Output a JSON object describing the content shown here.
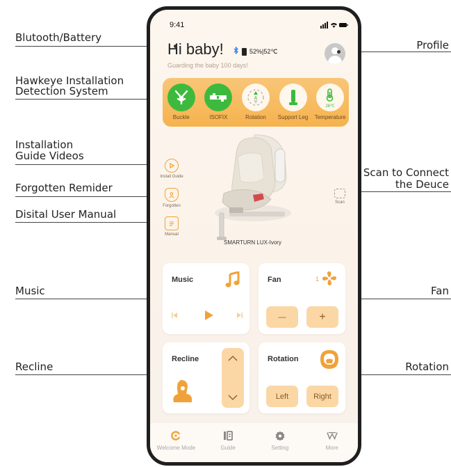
{
  "callouts": {
    "left": [
      "Blutooth/Battery",
      "Hawkeye Installation",
      "Detection System",
      "Installation",
      "Guide Videos",
      "Forgotten Remider",
      "Disital User Manual",
      "Music",
      "Recline"
    ],
    "right": [
      "Profile",
      "Scan to Connect",
      "the Deuce",
      "Fan",
      "Rotation"
    ]
  },
  "status_bar": {
    "time": "9:41"
  },
  "header": {
    "greeting": "Hi baby!",
    "battery_text": "52%|52℃",
    "subtitle": "Guarding the baby 100 days!"
  },
  "hawkeye": {
    "items": [
      {
        "label": "Buckle",
        "icon": "buckle-icon"
      },
      {
        "label": "ISOFIX",
        "icon": "isofix-icon"
      },
      {
        "label": "Rotation",
        "icon": "rotation-icon"
      },
      {
        "label": "Support Leg",
        "icon": "support-leg-icon"
      },
      {
        "label": "Temperature",
        "icon": "thermometer-icon",
        "value": "26℃"
      }
    ]
  },
  "side": {
    "install_guide": "Install Guide",
    "forgotten": "Forgotten",
    "manual": "Manual",
    "scan": "Scan"
  },
  "product": {
    "name": "SMARTURN LUX-Ivory"
  },
  "cards": {
    "music": {
      "title": "Music"
    },
    "fan": {
      "title": "Fan",
      "level": "1",
      "minus": "—",
      "plus": "+"
    },
    "recline": {
      "title": "Recline"
    },
    "rotation": {
      "title": "Rotation",
      "left": "Left",
      "right": "Right"
    }
  },
  "nav": {
    "items": [
      {
        "label": "Welcome Mode"
      },
      {
        "label": "Guide"
      },
      {
        "label": "Setting"
      },
      {
        "label": "More"
      }
    ]
  },
  "colors": {
    "accent": "#f0a23a",
    "hawk_bg": "#f6b24d",
    "green": "#3dba3d",
    "bluetooth": "#2f7de1"
  }
}
